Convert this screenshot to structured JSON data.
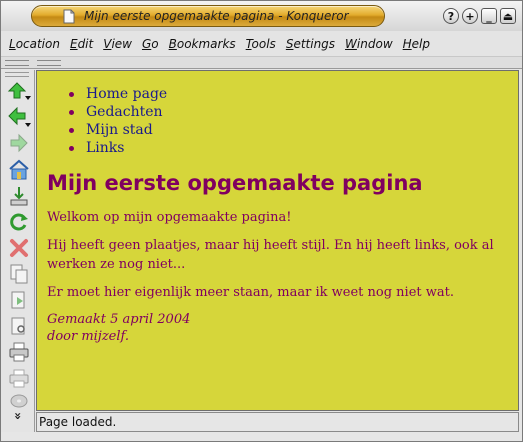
{
  "window": {
    "title": "Mijn eerste opgemaakte pagina - Konqueror",
    "buttons": {
      "help": "?",
      "maximize_plus": "+",
      "minimize": "_",
      "shade": "⏏"
    }
  },
  "menubar": {
    "items": [
      {
        "first": "L",
        "rest": "ocation"
      },
      {
        "first": "E",
        "rest": "dit"
      },
      {
        "first": "V",
        "rest": "iew"
      },
      {
        "first": "G",
        "rest": "o"
      },
      {
        "first": "B",
        "rest": "ookmarks"
      },
      {
        "first": "T",
        "rest": "ools"
      },
      {
        "first": "S",
        "rest": "ettings"
      },
      {
        "first": "W",
        "rest": "indow"
      },
      {
        "first": "H",
        "rest": "elp"
      }
    ]
  },
  "toolbar": {
    "icons": [
      "up-arrow-icon",
      "back-arrow-icon",
      "forward-arrow-icon",
      "home-icon",
      "download-icon",
      "reload-icon",
      "stop-icon",
      "edit-copy-icon",
      "edit-paste-icon",
      "find-icon",
      "print-icon",
      "print-preview-icon",
      "disc-icon"
    ],
    "more_glyph": "»"
  },
  "page": {
    "background": "#d6d63a",
    "heading_color": "#800060",
    "link_color": "#1a1a8c",
    "nav": [
      "Home page",
      "Gedachten",
      "Mijn stad",
      "Links"
    ],
    "heading": "Mijn eerste opgemaakte pagina",
    "paragraphs": [
      "Welkom op mijn opgemaakte pagina!",
      "Hij heeft geen plaatjes, maar hij heeft stijl. En hij heeft links, ook al werken ze nog niet...",
      "Er moet hier eigenlijk meer staan, maar ik weet nog niet wat."
    ],
    "signature": {
      "line1": "Gemaakt 5 april 2004",
      "line2": "door mijzelf."
    }
  },
  "status": {
    "text": "Page loaded."
  }
}
